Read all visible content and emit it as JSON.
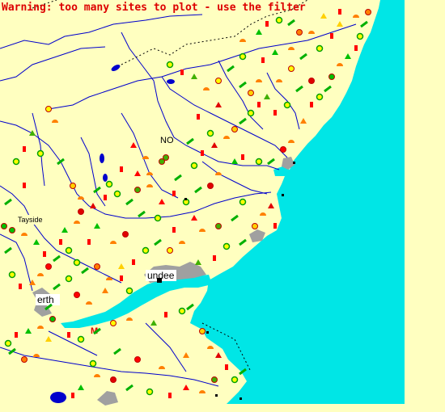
{
  "warning": "Warning: too many sites to plot - use the filter",
  "grid_label": "NO",
  "region_label": "Tayside",
  "places": {
    "dundee": "undee",
    "perth": "erth",
    "montrose": "M"
  },
  "colors": {
    "land": "#ffffc0",
    "sea": "#00e6e6",
    "river": "#0000cc",
    "urban": "#a0a0a0",
    "warning": "#dd0000",
    "boundary": "#000000"
  },
  "legend_symbols": [
    "yellow-red-disc",
    "orange-half",
    "green-triangle",
    "red-triangle",
    "green-circle",
    "red-target",
    "green-diagonal",
    "dotted-cluster"
  ]
}
